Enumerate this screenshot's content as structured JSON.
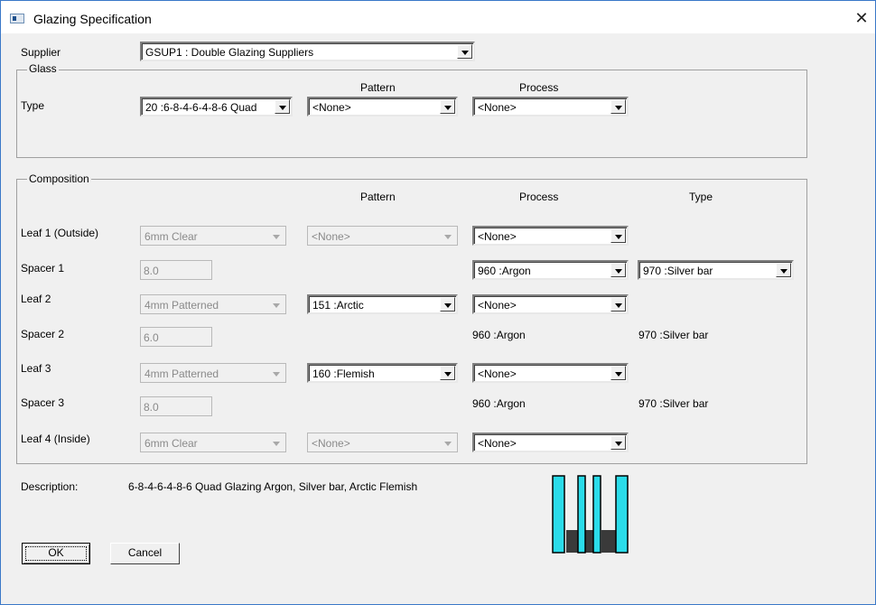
{
  "window": {
    "title": "Glazing Specification"
  },
  "supplier": {
    "label": "Supplier",
    "value": "GSUP1 : Double Glazing Suppliers"
  },
  "glass": {
    "legend": "Glass",
    "type_label": "Type",
    "pattern_header": "Pattern",
    "process_header": "Process",
    "type_value": "20  :6-8-4-6-4-8-6 Quad",
    "pattern_value": "<None>",
    "process_value": "<None>"
  },
  "composition": {
    "legend": "Composition",
    "headers": {
      "pattern": "Pattern",
      "process": "Process",
      "type": "Type"
    },
    "leaf1": {
      "label": "Leaf 1 (Outside)",
      "glass": "6mm Clear",
      "pattern": "<None>",
      "process": "<None>"
    },
    "spacer1": {
      "label": "Spacer 1",
      "width": "8.0",
      "process": "960 :Argon",
      "type": "970 :Silver bar"
    },
    "leaf2": {
      "label": "Leaf 2",
      "glass": "4mm Patterned",
      "pattern": "151 :Arctic",
      "process": "<None>"
    },
    "spacer2": {
      "label": "Spacer 2",
      "width": "6.0",
      "process": "960 :Argon",
      "type": "970 :Silver bar"
    },
    "leaf3": {
      "label": "Leaf 3",
      "glass": "4mm Patterned",
      "pattern": "160 :Flemish",
      "process": "<None>"
    },
    "spacer3": {
      "label": "Spacer 3",
      "width": "8.0",
      "process": "960 :Argon",
      "type": "970 :Silver bar"
    },
    "leaf4": {
      "label": "Leaf 4 (Inside)",
      "glass": "6mm Clear",
      "pattern": "<None>",
      "process": "<None>"
    }
  },
  "description": {
    "label": "Description:",
    "value": "6-8-4-6-4-8-6 Quad Glazing Argon, Silver bar, Arctic Flemish"
  },
  "buttons": {
    "ok": "OK",
    "cancel": "Cancel"
  },
  "colors": {
    "glass_pane": "#2bdcea",
    "spacer": "#3a3a3a",
    "window_border": "#3a78c8"
  }
}
